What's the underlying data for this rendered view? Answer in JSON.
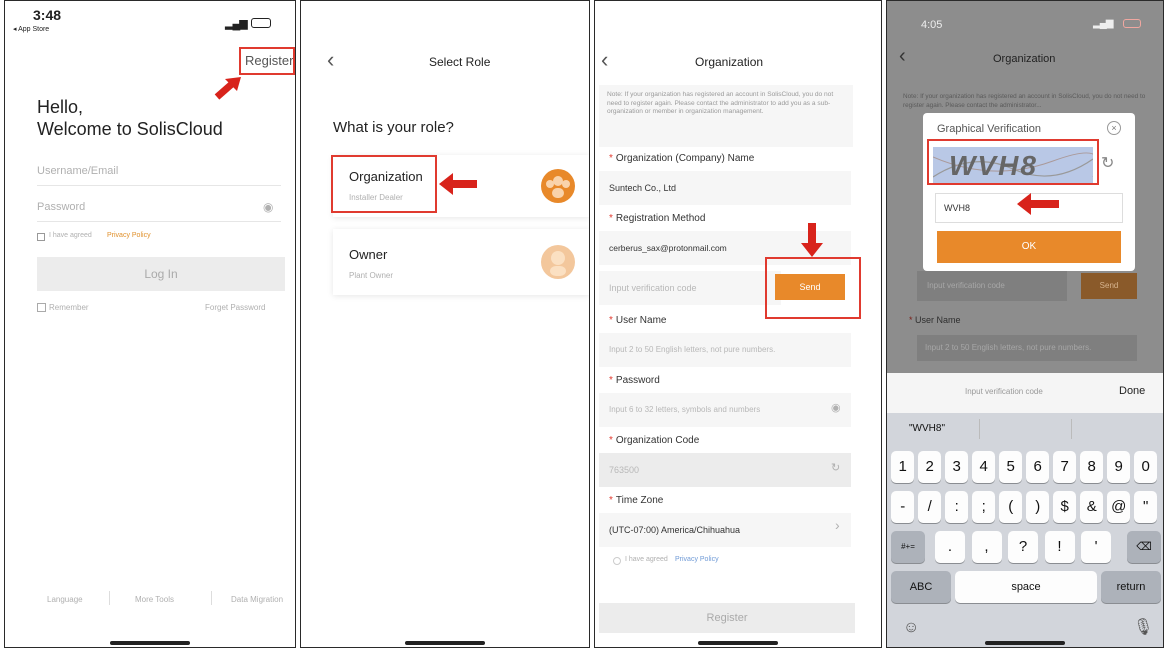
{
  "screen1": {
    "status_time": "3:48",
    "back_app": "◂ App Store",
    "register_link": "Register",
    "greeting_line1": "Hello,",
    "greeting_line2": "Welcome to SolisCloud",
    "username_placeholder": "Username/Email",
    "password_placeholder": "Password",
    "agree_text": "I have agreed",
    "privacy_link": "Privacy Policy",
    "login_button": "Log In",
    "remember_label": "Remember",
    "forgot_password": "Forget Password",
    "footer_links": [
      "Language",
      "More Tools",
      "Data Migration"
    ]
  },
  "screen2": {
    "header_title": "Select Role",
    "question": "What is your role?",
    "roles": [
      {
        "title": "Organization",
        "subtitle": "Installer Dealer"
      },
      {
        "title": "Owner",
        "subtitle": "Plant Owner"
      }
    ]
  },
  "screen3": {
    "header_title": "Organization",
    "note_prefix": "Note:",
    "note_text": "If your organization has registered an account in SolisCloud, you do not need to register again. Please contact the administrator to add you as a sub-organization or member in organization management.",
    "org_name_label": "Organization (Company) Name",
    "org_name_value": "Suntech Co., Ltd",
    "reg_method_label": "Registration Method",
    "email_value": "cerberus_sax@protonmail.com",
    "verification_placeholder": "Input verification code",
    "send_button": "Send",
    "username_label": "User Name",
    "username_placeholder": "Input 2 to 50 English letters, not pure numbers.",
    "password_label": "Password",
    "password_placeholder": "Input 6 to 32 letters, symbols and numbers",
    "org_code_label": "Organization Code",
    "org_code_value": "763500",
    "timezone_label": "Time Zone",
    "timezone_value": "(UTC-07:00) America/Chihuahua",
    "agree_text": "I have agreed",
    "privacy_link": "Privacy Policy",
    "register_button": "Register"
  },
  "screen4": {
    "status_time": "4:05",
    "header_title": "Organization",
    "note_prefix": "Note:",
    "note_text": "If your organization has registered an account in SolisCloud, you do not need to register again. Please contact the administrator...",
    "dialog_title": "Graphical Verification",
    "captcha_text": "WVH8",
    "captcha_input_value": "WVH8",
    "ok_button": "OK",
    "verification_placeholder": "Input verification code",
    "send_button": "Send",
    "username_label": "User Name",
    "username_placeholder": "Input 2 to 50 English letters, not pure numbers.",
    "keyboard_hint": "Input verification code",
    "done_button": "Done",
    "suggestion": "\"WVH8\"",
    "row1": [
      "1",
      "2",
      "3",
      "4",
      "5",
      "6",
      "7",
      "8",
      "9",
      "0"
    ],
    "row2": [
      "-",
      "/",
      ":",
      ";",
      "(",
      ")",
      "$",
      "&",
      "@",
      "\""
    ],
    "row3": [
      ".",
      ",",
      "?",
      "!",
      "'"
    ],
    "shift_key": "#+=",
    "abc_key": "ABC",
    "space_key": "space",
    "return_key": "return"
  },
  "colors": {
    "accent_orange": "#e8892a",
    "annotation_red": "#d8231b",
    "link_orange": "#e0902b"
  }
}
